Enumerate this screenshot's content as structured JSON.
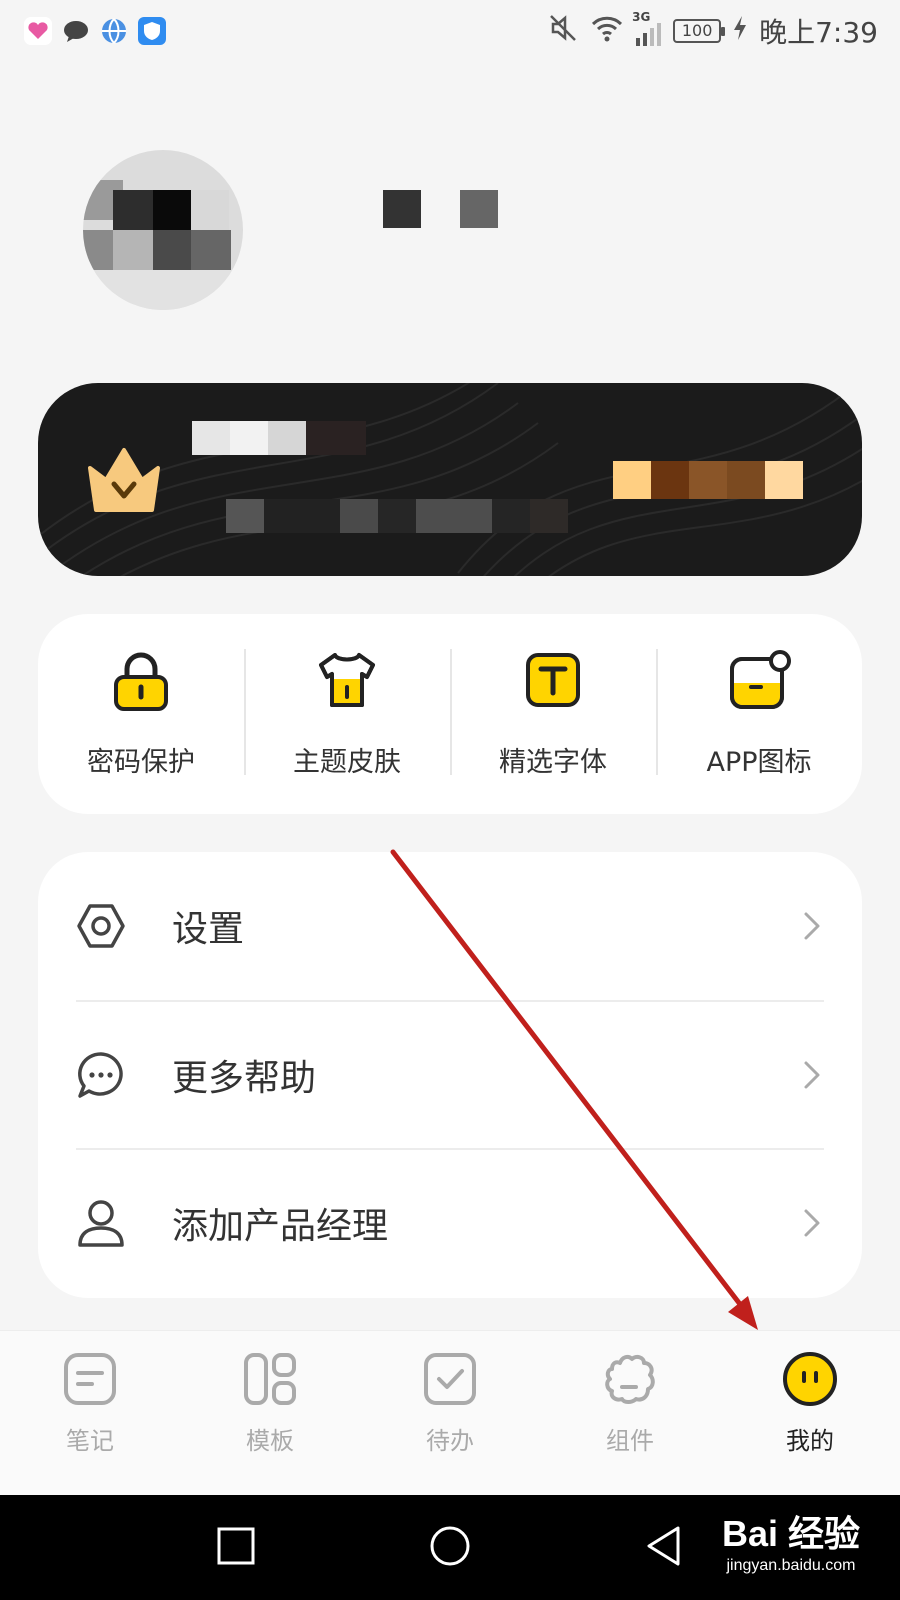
{
  "status_bar": {
    "battery": "100",
    "time": "晚上7:39",
    "network": "3G",
    "app_icons": [
      "heart-app-icon",
      "chat-app-icon",
      "globe-app-icon",
      "shield-app-icon"
    ]
  },
  "features": [
    {
      "label": "密码保护",
      "icon": "lock-icon"
    },
    {
      "label": "主题皮肤",
      "icon": "tshirt-icon"
    },
    {
      "label": "精选字体",
      "icon": "font-icon"
    },
    {
      "label": "APP图标",
      "icon": "app-badge-icon"
    }
  ],
  "menu": [
    {
      "label": "设置",
      "icon": "settings-icon"
    },
    {
      "label": "更多帮助",
      "icon": "chat-bubble-icon"
    },
    {
      "label": "添加产品经理",
      "icon": "person-icon"
    }
  ],
  "bottom_nav": [
    {
      "label": "笔记",
      "icon": "notes-icon",
      "active": false
    },
    {
      "label": "模板",
      "icon": "template-icon",
      "active": false
    },
    {
      "label": "待办",
      "icon": "todo-icon",
      "active": false
    },
    {
      "label": "组件",
      "icon": "widget-icon",
      "active": false
    },
    {
      "label": "我的",
      "icon": "smiley-icon",
      "active": true
    }
  ],
  "watermark": {
    "top": "Bai 经验",
    "bottom": "jingyan.baidu.com"
  },
  "colors": {
    "accent": "#ffd400",
    "card_dark": "#1b1b1b",
    "annotation": "#c0201c"
  }
}
